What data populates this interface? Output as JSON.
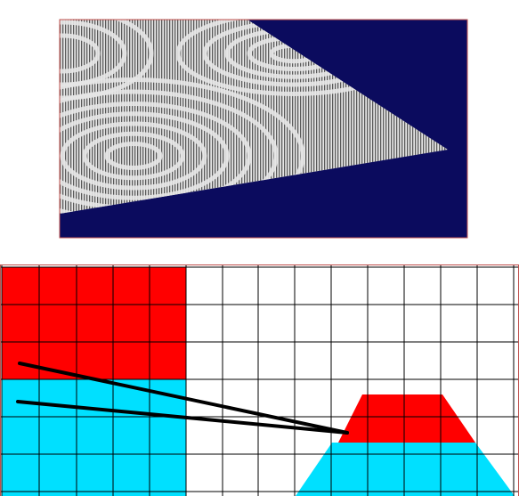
{
  "colors": {
    "background": "#ffffff",
    "render_bg": "#0b0b5e",
    "frame_border": "#c0504d",
    "plane_light": "#e6e6e6",
    "plane_dark": "#5a5a5a",
    "red": "#ff0000",
    "cyan": "#00e0ff",
    "grid_line": "#000000",
    "ray": "#000000"
  },
  "top_panel": {
    "description_icon": "moire-plane-render"
  },
  "bottom_panel": {
    "description_icon": "texture-sampling-grid"
  }
}
